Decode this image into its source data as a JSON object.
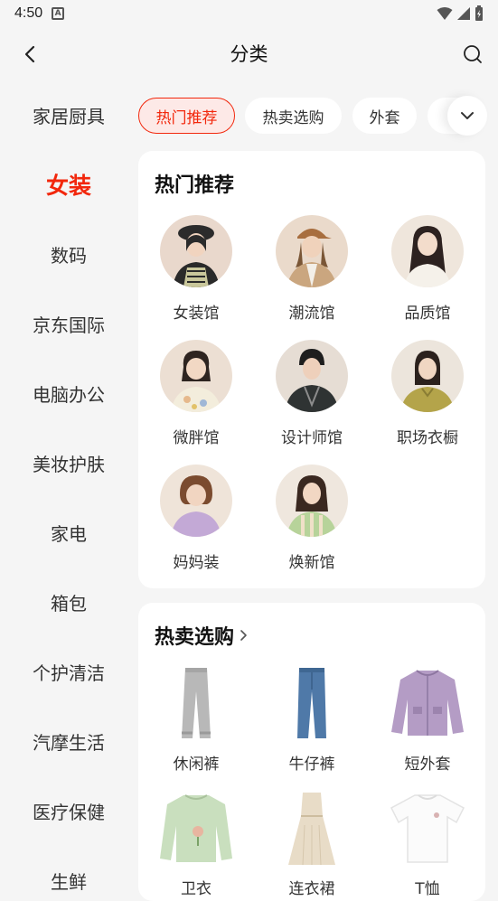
{
  "status_bar": {
    "time": "4:50",
    "notif_icon": "A"
  },
  "header": {
    "title": "分类"
  },
  "sidebar": {
    "items": [
      {
        "label": "家居厨具"
      },
      {
        "label": "女装"
      },
      {
        "label": "数码"
      },
      {
        "label": "京东国际"
      },
      {
        "label": "电脑办公"
      },
      {
        "label": "美妆护肤"
      },
      {
        "label": "家电"
      },
      {
        "label": "箱包"
      },
      {
        "label": "个护清洁"
      },
      {
        "label": "汽摩生活"
      },
      {
        "label": "医疗保健"
      },
      {
        "label": "生鲜"
      }
    ],
    "active_index": 1
  },
  "chips": [
    {
      "label": "热门推荐"
    },
    {
      "label": "热卖选购"
    },
    {
      "label": "外套"
    }
  ],
  "hot": {
    "title": "热门推荐",
    "items": [
      {
        "label": "女装馆"
      },
      {
        "label": "潮流馆"
      },
      {
        "label": "品质馆"
      },
      {
        "label": "微胖馆"
      },
      {
        "label": "设计师馆"
      },
      {
        "label": "职场衣橱"
      },
      {
        "label": "妈妈装"
      },
      {
        "label": "焕新馆"
      }
    ]
  },
  "sale": {
    "title": "热卖选购",
    "items": [
      {
        "label": "休闲裤"
      },
      {
        "label": "牛仔裤"
      },
      {
        "label": "短外套"
      },
      {
        "label": "卫衣"
      },
      {
        "label": "连衣裙"
      },
      {
        "label": "T恤"
      }
    ]
  },
  "colors": {
    "accent": "#f2270c",
    "chip_active_bg": "#fde9e7",
    "page_bg": "#f5f5f5"
  }
}
